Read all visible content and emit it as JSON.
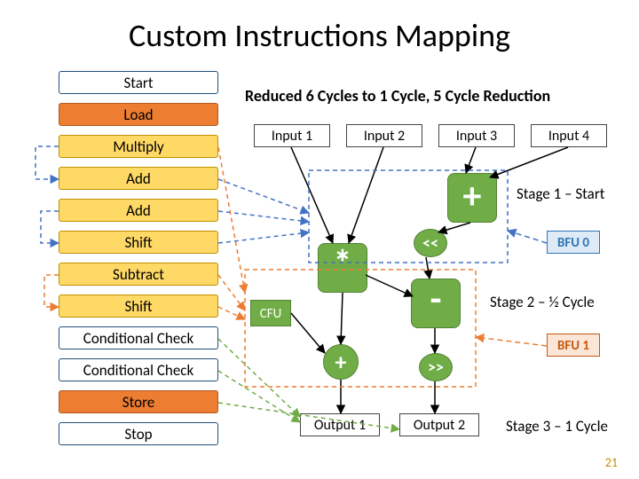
{
  "title": "Custom Instructions Mapping",
  "subtitle": "Reduced 6 Cycles to 1 Cycle, 5 Cycle Reduction",
  "steps": [
    {
      "label": "Start",
      "cls": "white"
    },
    {
      "label": "Load",
      "cls": "orange"
    },
    {
      "label": "Multiply",
      "cls": "yellow"
    },
    {
      "label": "Add",
      "cls": "yellow"
    },
    {
      "label": "Add",
      "cls": "yellow"
    },
    {
      "label": "Shift",
      "cls": "yellow"
    },
    {
      "label": "Subtract",
      "cls": "yellow"
    },
    {
      "label": "Shift",
      "cls": "yellow"
    },
    {
      "label": "Conditional Check",
      "cls": "white"
    },
    {
      "label": "Conditional Check",
      "cls": "white"
    },
    {
      "label": "Store",
      "cls": "orange"
    },
    {
      "label": "Stop",
      "cls": "white"
    }
  ],
  "inputs": [
    "Input 1",
    "Input 2",
    "Input 3",
    "Input 4"
  ],
  "outputs": [
    "Output 1",
    "Output 2"
  ],
  "ops": {
    "plus_big": "+",
    "mult": "*",
    "minus": "-",
    "plus_small": "+",
    "shift_left": "<<",
    "shift_right": ">>"
  },
  "cfu": "CFU",
  "bfu": {
    "b0": "BFU 0",
    "b1": "BFU 1"
  },
  "stages": {
    "s1": "Stage 1 – Start",
    "s2": "Stage 2 – ½ Cycle",
    "s3": "Stage 3 – 1 Cycle"
  },
  "pagenum": "21",
  "colors": {
    "blue_dash": "#4472c4",
    "orange_dash": "#ed7d31",
    "green_dash": "#70ad47"
  }
}
